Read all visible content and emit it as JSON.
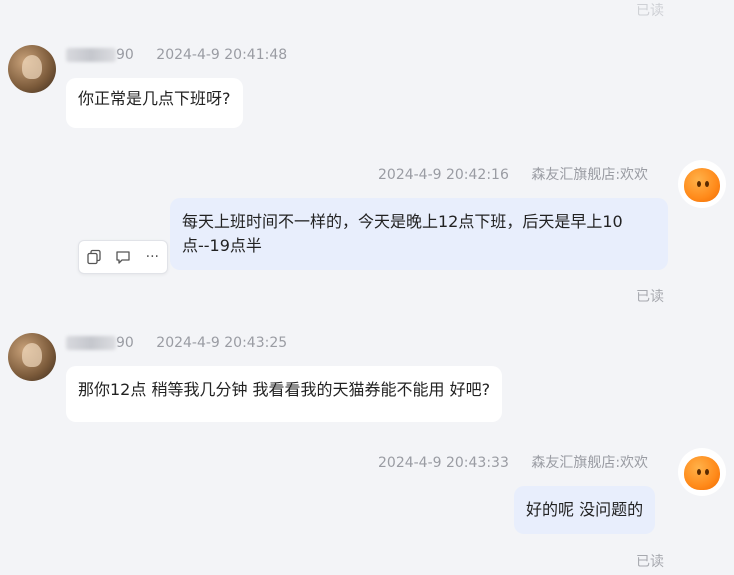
{
  "top_status": "已读",
  "messages": [
    {
      "sender": "90",
      "time": "2024-4-9 20:41:48",
      "text": "你正常是几点下班呀?"
    },
    {
      "time": "2024-4-9 20:42:16",
      "sender": "森友汇旗舰店:欢欢",
      "text_line1": "每天上班时间不一样的，今天是晚上12点下班，后天是早上10",
      "text_line2": "点--19点半",
      "status": "已读"
    },
    {
      "sender": "90",
      "time": "2024-4-9 20:43:25",
      "text": "那你12点 稍等我几分钟 我看看我的天猫券能不能用 好吧?"
    },
    {
      "time": "2024-4-9 20:43:33",
      "sender": "森友汇旗舰店:欢欢",
      "text": "好的呢  没问题的",
      "status": "已读"
    }
  ],
  "toolbar": {
    "items": [
      "copy-icon",
      "reply-icon",
      "more-icon"
    ],
    "more_label": "···"
  }
}
